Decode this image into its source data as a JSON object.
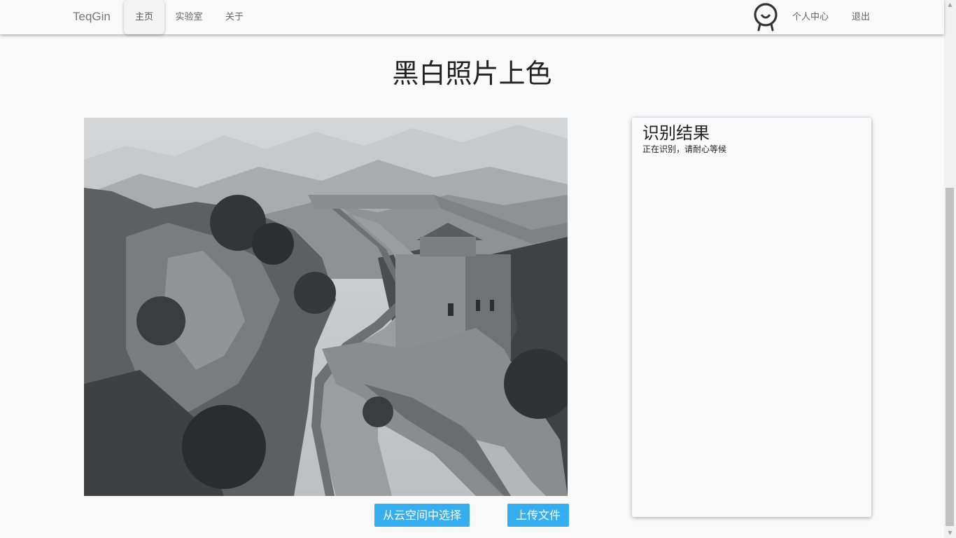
{
  "nav": {
    "brand": "TeqGin",
    "items": [
      {
        "label": "主页",
        "active": true
      },
      {
        "label": "实验室",
        "active": false
      },
      {
        "label": "关于",
        "active": false
      }
    ],
    "user_center": "个人中心",
    "logout": "退出",
    "avatar_icon": "smiley-avatar-icon"
  },
  "main": {
    "title": "黑白照片上色",
    "photo_description": "Black-and-white photo of the Great Wall winding over mountains",
    "buttons": {
      "cloud_select": "从云空间中选择",
      "upload": "上传文件"
    }
  },
  "result": {
    "title": "识别结果",
    "status": "正在识别，请耐心等候"
  },
  "colors": {
    "accent": "#35aef0",
    "background": "#f9f9fa"
  }
}
